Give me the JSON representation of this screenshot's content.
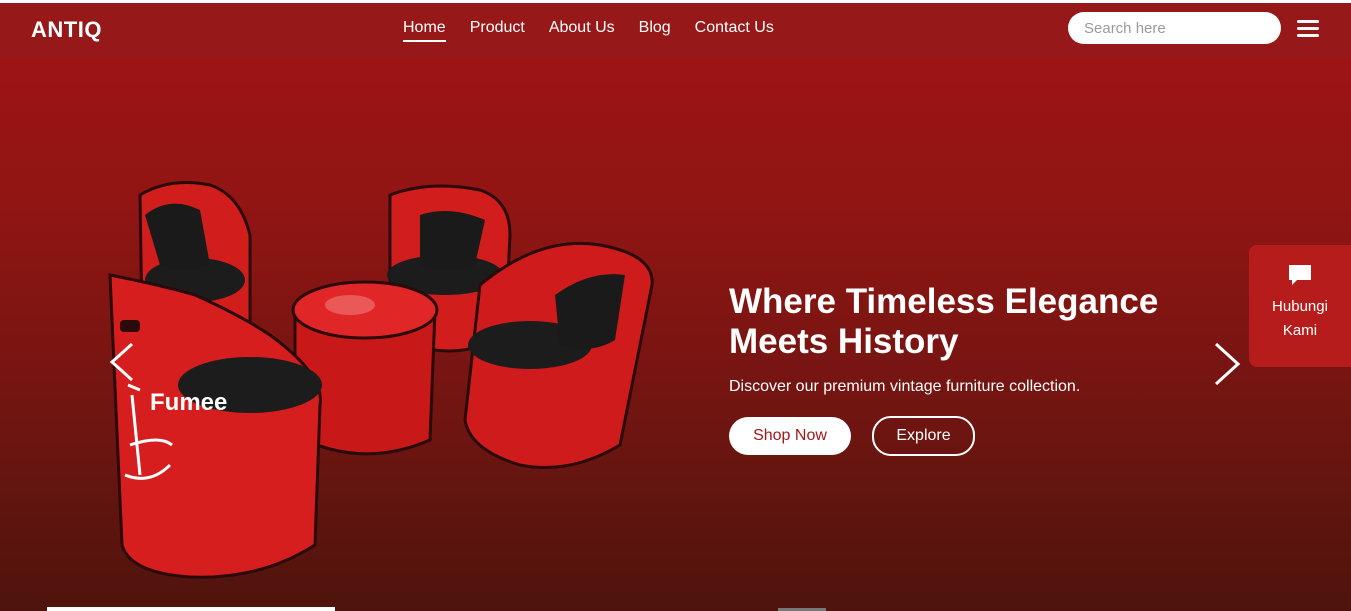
{
  "brand": {
    "name": "ANTIQ"
  },
  "nav": {
    "links": [
      {
        "label": "Home",
        "active": true
      },
      {
        "label": "Product"
      },
      {
        "label": "About Us"
      },
      {
        "label": "Blog"
      },
      {
        "label": "Contact Us"
      }
    ]
  },
  "search": {
    "placeholder": "Search here",
    "value": ""
  },
  "hero": {
    "headline": "Where Timeless Elegance Meets History",
    "subline": "Discover our premium vintage furniture collection.",
    "shop_label": "Shop Now",
    "explore_label": "Explore",
    "image_text": "Fumee"
  },
  "floating_contact": {
    "label": "Hubungi Kami",
    "icon": "chat-bubble-icon"
  },
  "icons": {
    "menu": "hamburger-menu-icon",
    "prev": "chevron-left-icon",
    "next": "chevron-right-icon"
  },
  "colors": {
    "primary": "#a31414",
    "navbar": "#961919",
    "contact_bg": "#b71c1c",
    "button_text": "#a01818"
  }
}
